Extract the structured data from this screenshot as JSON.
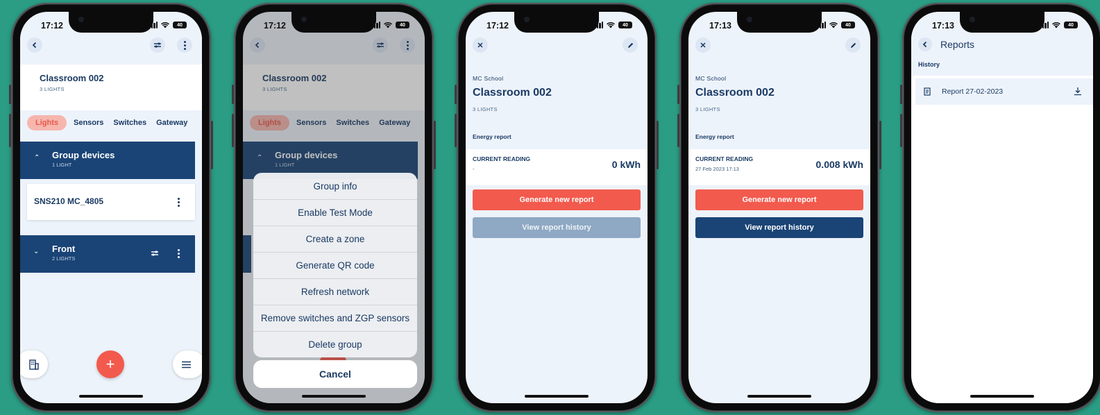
{
  "colors": {
    "background": "#2a9d84",
    "navy": "#1a4476",
    "accent": "#f25a4d",
    "active_tab_bg": "#f6b6ae"
  },
  "phone1": {
    "time": "17:12",
    "battery": "40",
    "room_title": "Classroom 002",
    "room_sub": "3 LIGHTS",
    "tabs": [
      "Lights",
      "Sensors",
      "Switches",
      "Gateway"
    ],
    "group1": {
      "title": "Group devices",
      "sub": "1 LIGHT"
    },
    "device": "SNS210 MC_4805",
    "group2": {
      "title": "Front",
      "sub": "2 LIGHTS"
    },
    "icons": {
      "back": "back-icon",
      "tune": "tune-icon",
      "more": "more-icon",
      "building": "building-icon",
      "add": "add-icon",
      "menu": "menu-icon"
    }
  },
  "phone2": {
    "time": "17:12",
    "battery": "40",
    "room_title": "Classroom 002",
    "room_sub": "3 LIGHTS",
    "tabs": [
      "Lights",
      "Sensors",
      "Switches",
      "Gateway"
    ],
    "group1": {
      "title": "Group devices",
      "sub": "1 LIGHT"
    },
    "menu": [
      "Group info",
      "Enable Test Mode",
      "Create a zone",
      "Generate QR code",
      "Refresh network",
      "Remove switches and ZGP sensors",
      "Delete group"
    ],
    "cancel": "Cancel"
  },
  "phone3": {
    "time": "17:12",
    "battery": "40",
    "school": "MC School",
    "room_title": "Classroom 002",
    "room_sub": "3 LIGHTS",
    "section": "Energy report",
    "reading_label": "CURRENT READING",
    "reading_date": "-",
    "reading_value": "0 kWh",
    "generate": "Generate new report",
    "history": "View report history"
  },
  "phone4": {
    "time": "17:13",
    "battery": "40",
    "school": "MC School",
    "room_title": "Classroom 002",
    "room_sub": "3 LIGHTS",
    "section": "Energy report",
    "reading_label": "CURRENT READING",
    "reading_date": "27 Feb 2023 17:13",
    "reading_value": "0.008 kWh",
    "generate": "Generate new report",
    "history": "View report history"
  },
  "phone5": {
    "time": "17:13",
    "battery": "40",
    "title": "Reports",
    "section": "History",
    "report": "Report 27-02-2023"
  }
}
